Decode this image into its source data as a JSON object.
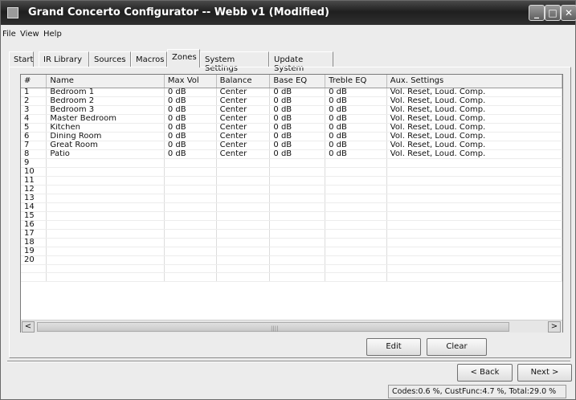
{
  "window": {
    "title": "Grand Concerto Configurator -- Webb v1 (Modified)"
  },
  "menu": [
    "File",
    "View",
    "Help"
  ],
  "tabs": [
    "Start",
    "IR Library",
    "Sources",
    "Macros",
    "Zones",
    "System Settings",
    "Update System"
  ],
  "active_tab": "Zones",
  "table": {
    "columns": [
      "#",
      "Name",
      "Max Vol",
      "Balance",
      "Base EQ",
      "Treble EQ",
      "Aux. Settings"
    ],
    "rows": [
      [
        "1",
        "Bedroom 1",
        "0 dB",
        "Center",
        "0 dB",
        "0 dB",
        "Vol. Reset, Loud. Comp."
      ],
      [
        "2",
        "Bedroom 2",
        "0 dB",
        "Center",
        "0 dB",
        "0 dB",
        "Vol. Reset, Loud. Comp."
      ],
      [
        "3",
        "Bedroom 3",
        "0 dB",
        "Center",
        "0 dB",
        "0 dB",
        "Vol. Reset, Loud. Comp."
      ],
      [
        "4",
        "Master Bedroom",
        "0 dB",
        "Center",
        "0 dB",
        "0 dB",
        "Vol. Reset, Loud. Comp."
      ],
      [
        "5",
        "Kitchen",
        "0 dB",
        "Center",
        "0 dB",
        "0 dB",
        "Vol. Reset, Loud. Comp."
      ],
      [
        "6",
        "Dining Room",
        "0 dB",
        "Center",
        "0 dB",
        "0 dB",
        "Vol. Reset, Loud. Comp."
      ],
      [
        "7",
        "Great Room",
        "0 dB",
        "Center",
        "0 dB",
        "0 dB",
        "Vol. Reset, Loud. Comp."
      ],
      [
        "8",
        "Patio",
        "0 dB",
        "Center",
        "0 dB",
        "0 dB",
        "Vol. Reset, Loud. Comp."
      ],
      [
        "9",
        "",
        "",
        "",
        "",
        "",
        ""
      ],
      [
        "10",
        "",
        "",
        "",
        "",
        "",
        ""
      ],
      [
        "11",
        "",
        "",
        "",
        "",
        "",
        ""
      ],
      [
        "12",
        "",
        "",
        "",
        "",
        "",
        ""
      ],
      [
        "13",
        "",
        "",
        "",
        "",
        "",
        ""
      ],
      [
        "14",
        "",
        "",
        "",
        "",
        "",
        ""
      ],
      [
        "15",
        "",
        "",
        "",
        "",
        "",
        ""
      ],
      [
        "16",
        "",
        "",
        "",
        "",
        "",
        ""
      ],
      [
        "17",
        "",
        "",
        "",
        "",
        "",
        ""
      ],
      [
        "18",
        "",
        "",
        "",
        "",
        "",
        ""
      ],
      [
        "19",
        "",
        "",
        "",
        "",
        "",
        ""
      ],
      [
        "20",
        "",
        "",
        "",
        "",
        "",
        ""
      ],
      [
        "",
        "",
        "",
        "",
        "",
        "",
        ""
      ],
      [
        "",
        "",
        "",
        "",
        "",
        "",
        ""
      ]
    ]
  },
  "buttons": {
    "edit": "Edit",
    "clear": "Clear",
    "back": "< Back",
    "next": "Next >"
  },
  "status": "Codes:0.6 %, CustFunc:4.7 %, Total:29.0 %",
  "icons": {
    "minimize": "_",
    "maximize": "□",
    "close": "✕",
    "scroll_left": "<",
    "scroll_right": ">"
  }
}
